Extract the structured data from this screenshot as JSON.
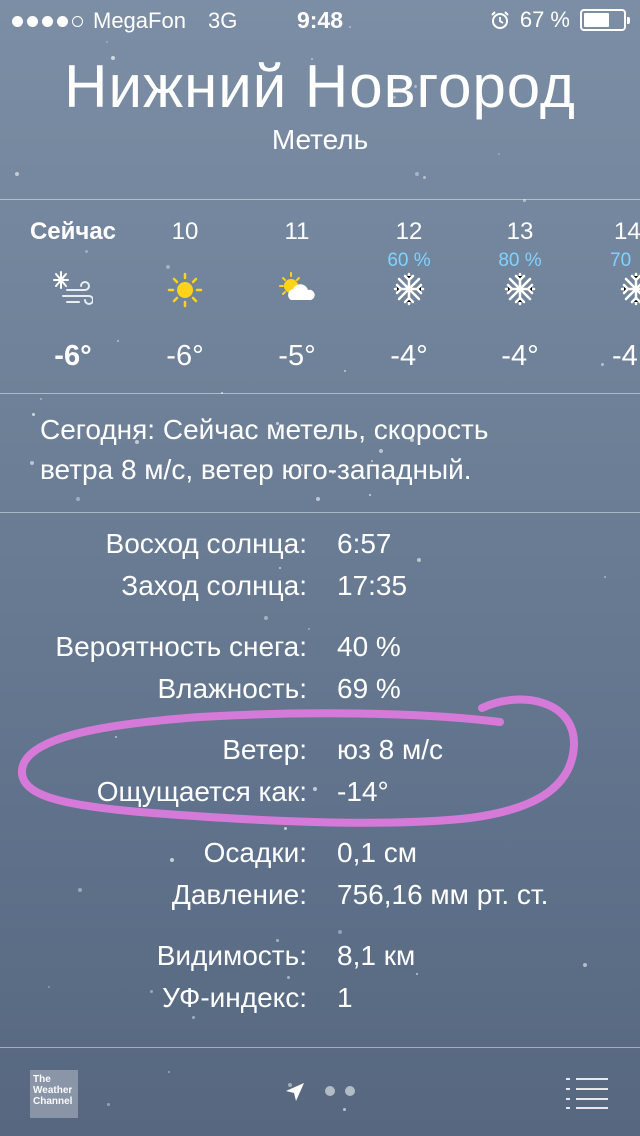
{
  "status_bar": {
    "carrier": "MegaFon",
    "network": "3G",
    "time": "9:48",
    "battery": "67 %",
    "battery_level": 0.67,
    "signal_bars": 4,
    "signal_total": 5,
    "alarm_icon": "alarm-clock-icon"
  },
  "header": {
    "city": "Нижний Новгород",
    "condition": "Метель"
  },
  "hourly": [
    {
      "label": "Сейчас",
      "pct": "",
      "icon": "wind-snow-icon",
      "temp": "-6°",
      "now": true
    },
    {
      "label": "10",
      "pct": "",
      "icon": "sun-icon",
      "temp": "-6°"
    },
    {
      "label": "11",
      "pct": "",
      "icon": "partly-cloudy-icon",
      "temp": "-5°"
    },
    {
      "label": "12",
      "pct": "60 %",
      "icon": "snowflake-icon",
      "temp": "-4°"
    },
    {
      "label": "13",
      "pct": "80 %",
      "icon": "snowflake-icon",
      "temp": "-4°"
    },
    {
      "label": "14",
      "pct": "70",
      "icon": "snowflake-icon",
      "temp": "-4"
    }
  ],
  "summary": {
    "line1": "Сегодня: Сейчас метель, скорость",
    "line2": "ветра 8 м/с, ветер юго-западный."
  },
  "details": [
    {
      "label": "Восход солнца:",
      "value": "6:57"
    },
    {
      "label": "Заход солнца:",
      "value": "17:35"
    },
    {
      "label": "Вероятность снега:",
      "value": "40 %"
    },
    {
      "label": "Влажность:",
      "value": "69 %"
    },
    {
      "label": "Ветер:",
      "value": "юз 8 м/с"
    },
    {
      "label": "Ощущается как:",
      "value": "-14°"
    },
    {
      "label": "Осадки:",
      "value": "0,1 см"
    },
    {
      "label": "Давление:",
      "value": "756,16 мм рт. ст."
    },
    {
      "label": "Видимость:",
      "value": "8,1 км"
    },
    {
      "label": "УФ-индекс:",
      "value": "1"
    }
  ],
  "bottom_bar": {
    "logo_text": [
      "The",
      "Weather",
      "Channel"
    ],
    "page_count": 3,
    "current_page": 0
  },
  "colors": {
    "precip_pct": "#7fd3ff",
    "annotation": "#d67ad9",
    "sun": "#ffd21c"
  }
}
